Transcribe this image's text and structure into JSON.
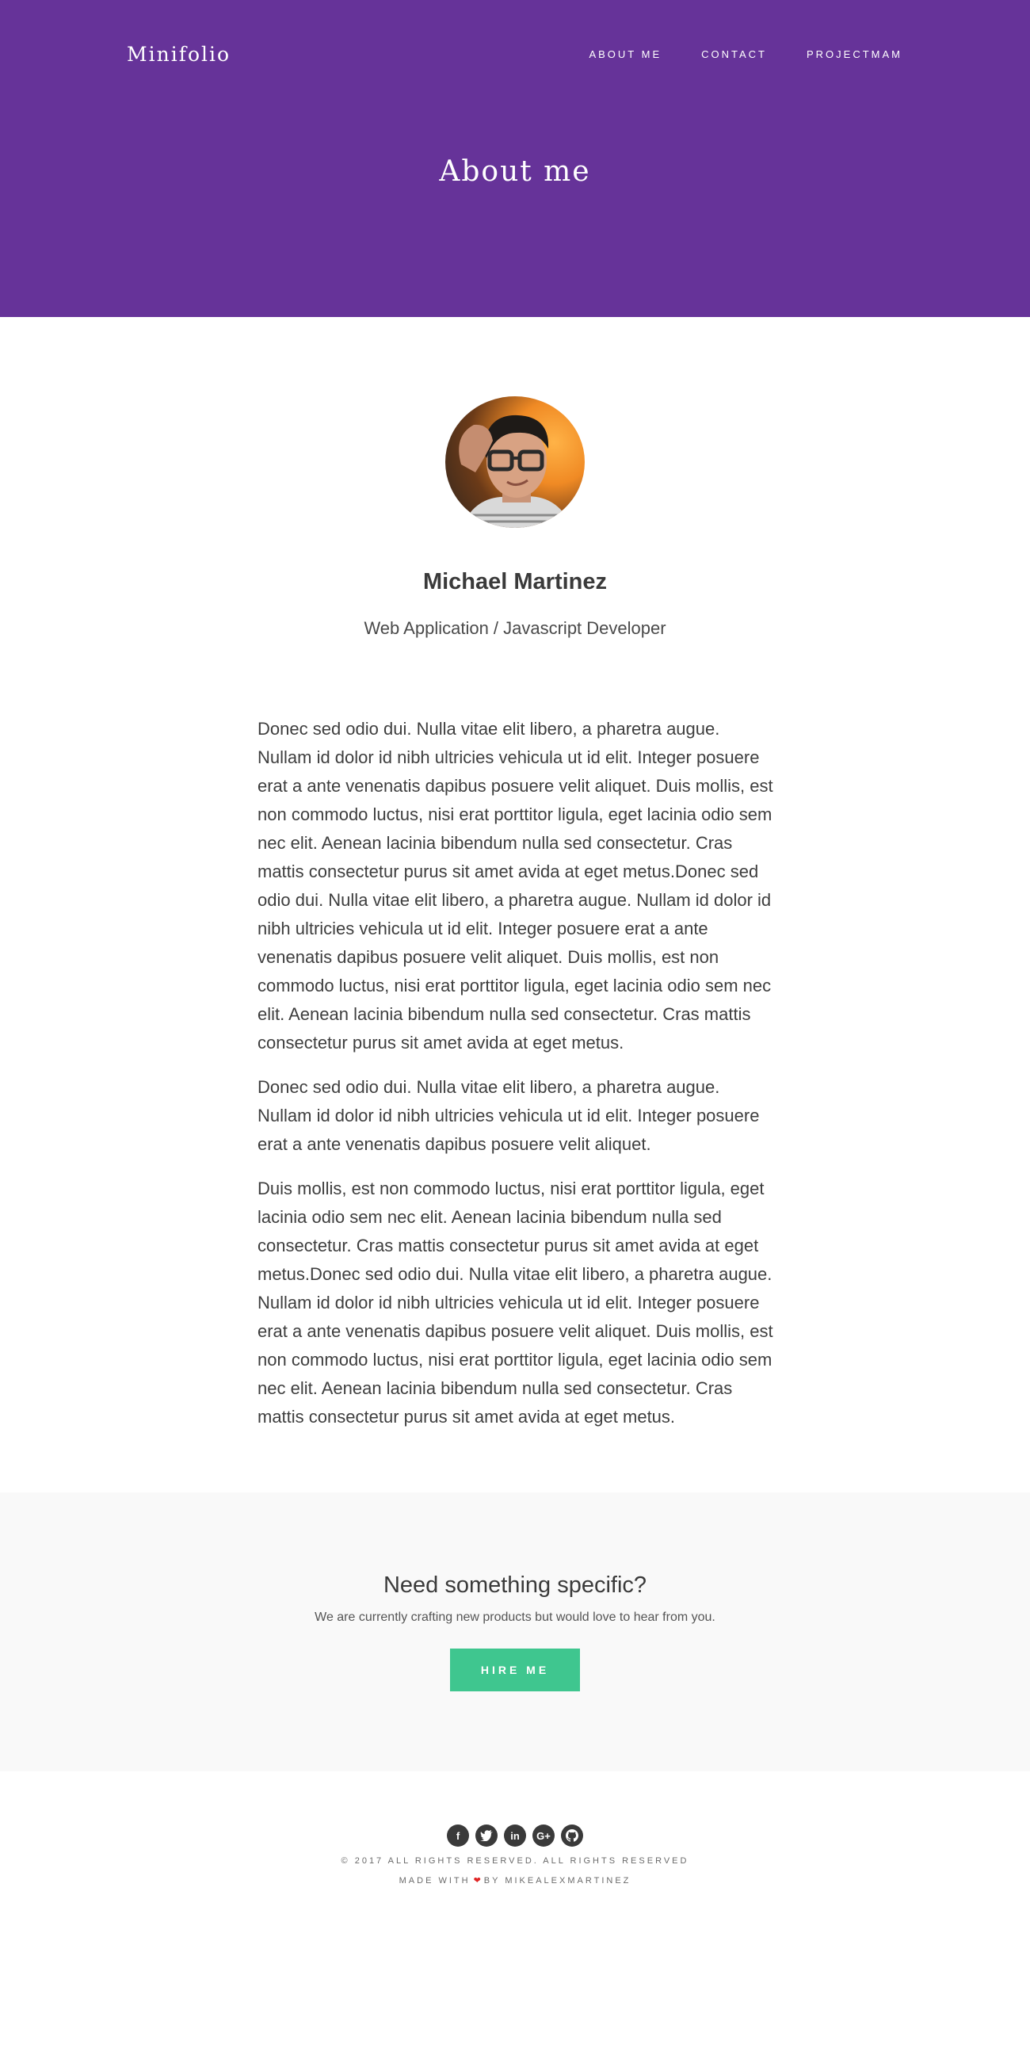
{
  "header": {
    "brand": "Minifolio",
    "nav": [
      "ABOUT ME",
      "CONTACT",
      "PROJECTMAM"
    ],
    "title": "About me",
    "background_color": "#663399"
  },
  "profile": {
    "name": "Michael Martinez",
    "role": "Web Application / Javascript Developer",
    "photo": "avatar-photo"
  },
  "bio": {
    "paragraphs": [
      "Donec sed odio dui. Nulla vitae elit libero, a pharetra augue. Nullam id dolor id nibh ultricies vehicula ut id elit. Integer posuere erat a ante venenatis dapibus posuere velit aliquet. Duis mollis, est non commodo luctus, nisi erat porttitor ligula, eget lacinia odio sem nec elit. Aenean lacinia bibendum nulla sed consectetur. Cras mattis consectetur purus sit amet avida at eget metus.Donec sed odio dui. Nulla vitae elit libero, a pharetra augue. Nullam id dolor id nibh ultricies vehicula ut id elit. Integer posuere erat a ante venenatis dapibus posuere velit aliquet. Duis mollis, est non commodo luctus, nisi erat porttitor ligula, eget lacinia odio sem nec elit. Aenean lacinia bibendum nulla sed consectetur. Cras mattis consectetur purus sit amet avida at eget metus.",
      "Donec sed odio dui. Nulla vitae elit libero, a pharetra augue. Nullam id dolor id nibh ultricies vehicula ut id elit. Integer posuere erat a ante venenatis dapibus posuere velit aliquet.",
      "Duis mollis, est non commodo luctus, nisi erat porttitor ligula, eget lacinia odio sem nec elit. Aenean lacinia bibendum nulla sed consectetur. Cras mattis consectetur purus sit amet avida at eget metus.Donec sed odio dui. Nulla vitae elit libero, a pharetra augue. Nullam id dolor id nibh ultricies vehicula ut id elit. Integer posuere erat a ante venenatis dapibus posuere velit aliquet. Duis mollis, est non commodo luctus, nisi erat porttitor ligula, eget lacinia odio sem nec elit. Aenean lacinia bibendum nulla sed consectetur. Cras mattis consectetur purus sit amet avida at eget metus."
    ]
  },
  "cta": {
    "title": "Need something specific?",
    "text": "We are currently crafting new products but would love to hear from you.",
    "button": "HIRE ME",
    "button_color": "#3fc68f"
  },
  "footer": {
    "social": [
      {
        "icon": "facebook-icon",
        "glyph": "f"
      },
      {
        "icon": "twitter-icon",
        "glyph": "t"
      },
      {
        "icon": "linkedin-icon",
        "glyph": "in"
      },
      {
        "icon": "google-plus-icon",
        "glyph": "G+"
      },
      {
        "icon": "github-icon",
        "glyph": "gh"
      }
    ],
    "copyright": "© 2017 ALL RIGHTS RESERVED. ALL RIGHTS RESERVED",
    "made_with_prefix": "MADE WITH",
    "made_with_suffix": "BY MIKEALEXMARTINEZ",
    "heart_icon": "heart-icon"
  }
}
